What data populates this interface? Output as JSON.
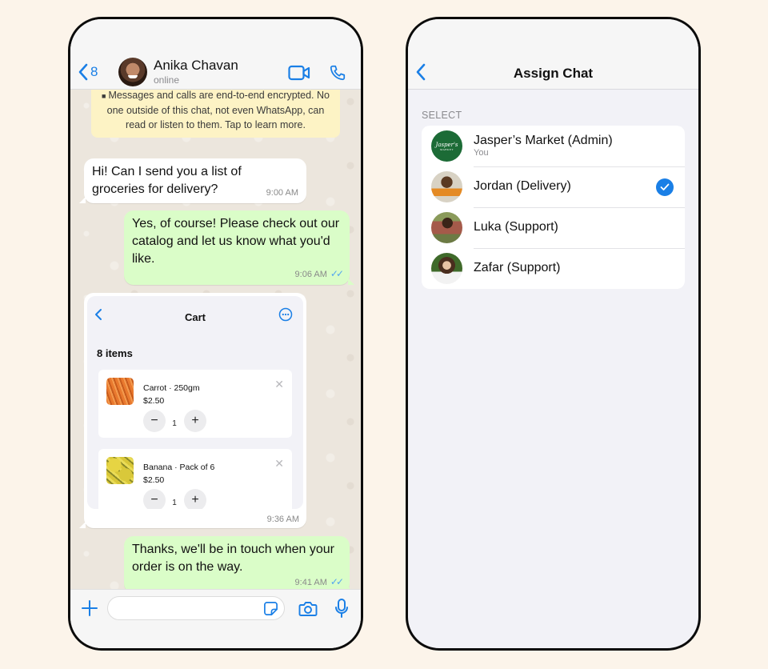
{
  "chat": {
    "header": {
      "back_count": "8",
      "contact_name": "Anika Chavan",
      "contact_status": "online"
    },
    "encryption_notice": "Messages and calls are end-to-end encrypted. No one outside of this chat, not even WhatsApp, can read or listen to them. Tap to learn more.",
    "messages": [
      {
        "direction": "incoming",
        "text": "Hi! Can I send you a list of groceries for delivery?",
        "time": "9:00 AM"
      },
      {
        "direction": "outgoing",
        "text": "Yes, of course! Please check out our catalog and let us know what you'd like.",
        "time": "9:06 AM",
        "status": "read"
      },
      {
        "direction": "incoming",
        "type": "cart",
        "time": "9:36 AM",
        "cart": {
          "title": "Cart",
          "item_count": "8 items",
          "items": [
            {
              "name": "Carrot · 250gm",
              "price": "$2.50",
              "quantity": "1"
            },
            {
              "name": "Banana · Pack of 6",
              "price": "$2.50",
              "quantity": "1"
            }
          ]
        }
      },
      {
        "direction": "outgoing",
        "text": "Thanks, we'll be in touch when your order is on the way.",
        "time": "9:41 AM",
        "status": "read"
      }
    ],
    "input": {
      "value": "",
      "placeholder": ""
    },
    "colors": {
      "accent": "#1a7fe6",
      "outgoing_bubble": "#dafdc8",
      "incoming_bubble": "#ffffff",
      "encryption_banner": "#fdf3c5",
      "read_ticks": "#53a6f0"
    }
  },
  "assign": {
    "title": "Assign Chat",
    "section_label": "SELECT",
    "agents": [
      {
        "name": "Jasper’s Market (Admin)",
        "subtitle": "You",
        "selected": false,
        "avatar": "jaspers-market-logo",
        "logo_text": "Jasper's",
        "logo_subtext": "MARKET"
      },
      {
        "name": "Jordan (Delivery)",
        "subtitle": "",
        "selected": true,
        "avatar": "photo"
      },
      {
        "name": "Luka (Support)",
        "subtitle": "",
        "selected": false,
        "avatar": "photo"
      },
      {
        "name": "Zafar (Support)",
        "subtitle": "",
        "selected": false,
        "avatar": "photo"
      }
    ],
    "colors": {
      "check": "#1a7fe6",
      "background": "#f2f2f7"
    }
  },
  "icons": {
    "back": "chevron-left-icon",
    "video": "video-camera-icon",
    "call": "phone-icon",
    "lock": "lock-icon",
    "read_ticks": "double-check-icon",
    "more": "ellipsis-circle-icon",
    "remove": "close-icon",
    "minus": "minus-icon",
    "plus": "plus-icon",
    "attach": "plus-icon",
    "sticker": "sticker-icon",
    "camera": "camera-icon",
    "mic": "microphone-icon",
    "selected": "checkmark-circle-icon"
  }
}
